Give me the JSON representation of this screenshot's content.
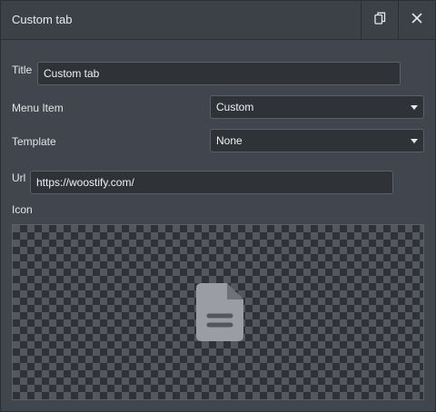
{
  "header": {
    "title": "Custom tab",
    "icons": {
      "copy": "copy-icon",
      "close": "close-icon"
    }
  },
  "form": {
    "title_label": "Title",
    "title_value": "Custom tab",
    "menu_item_label": "Menu Item",
    "menu_item_value": "Custom",
    "template_label": "Template",
    "template_value": "None",
    "url_label": "Url",
    "url_value": "https://woostify.com/",
    "icon_label": "Icon",
    "icon_preview": "document-icon"
  },
  "colors": {
    "panel_bg": "#41464e",
    "field_bg": "#2f3237",
    "field_border": "#5a6069",
    "text": "#e6e8ea"
  }
}
